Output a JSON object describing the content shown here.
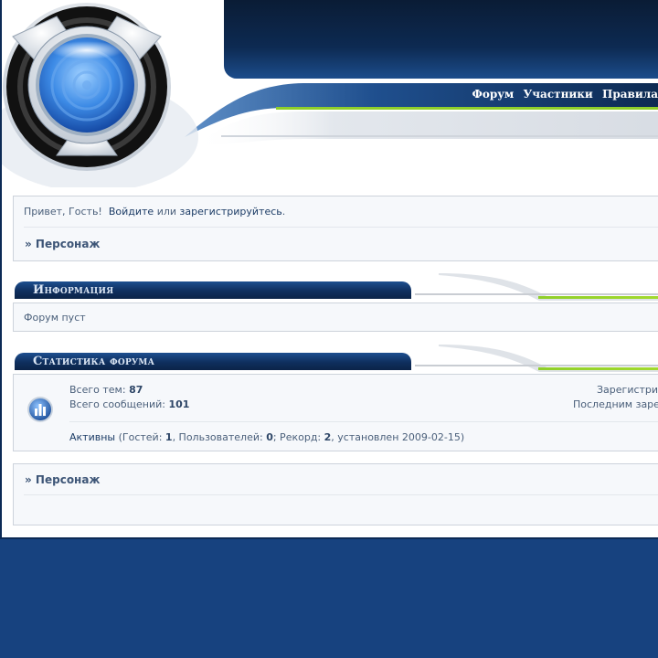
{
  "nav": {
    "items": [
      {
        "label": "Форум"
      },
      {
        "label": "Участники"
      },
      {
        "label": "Правила"
      }
    ]
  },
  "welcome": {
    "greeting": "Привет, Гость!",
    "login": "Войдите",
    "or": "или",
    "register": "зарегистрируйтесь",
    "period": "."
  },
  "breadcrumb": "» Персонаж",
  "info": {
    "title": "Информация",
    "text": "Форум пуст"
  },
  "stats": {
    "title": "Статистика форума",
    "topics_label": "Всего тем:",
    "topics_value": "87",
    "posts_label": "Всего сообщений:",
    "posts_value": "101",
    "registered_label": "Зарегистрир",
    "last_label": "Последним заре",
    "online_link": "Активны",
    "online_guests_label": "(Гостей:",
    "online_guests": "1",
    "online_users_label": ", Пользователей:",
    "online_users": "0",
    "online_record_label": "; Рекорд:",
    "online_record": "2",
    "online_set_label": ", установлен 2009-02-15)"
  },
  "colors": {
    "background": "#17427f",
    "header_dark": "#0d2a52",
    "accent_green": "#8fcf2a",
    "link": "#1c3c66"
  },
  "icons": {
    "logo": "eye-lens-logo",
    "stats": "bar-chart-icon"
  }
}
